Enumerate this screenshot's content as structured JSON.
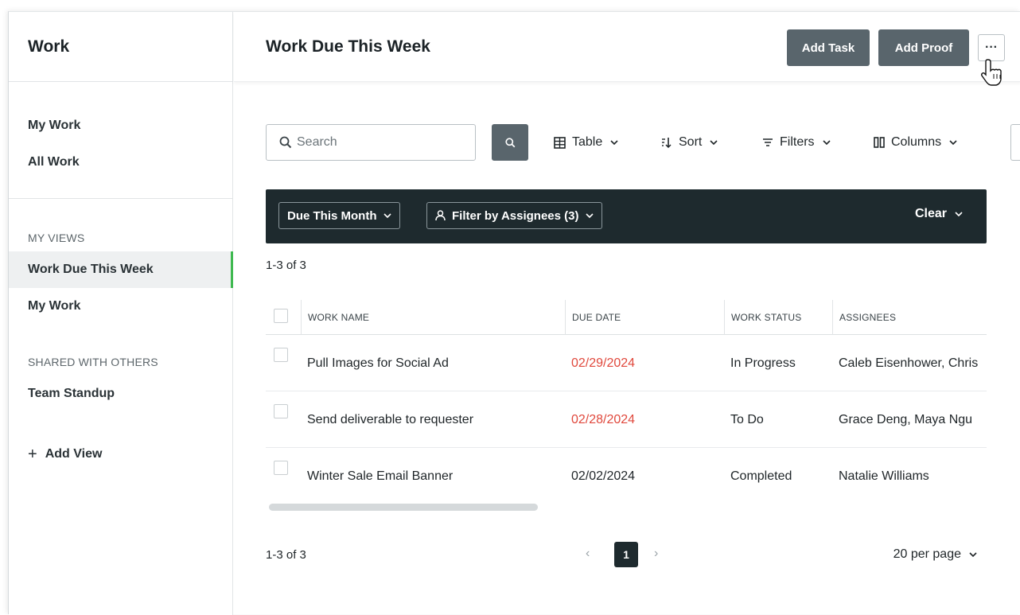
{
  "sidebar": {
    "title": "Work",
    "links": [
      {
        "label": "My Work"
      },
      {
        "label": "All Work"
      }
    ],
    "my_views_caption": "MY VIEWS",
    "my_views": [
      {
        "label": "Work Due This Week",
        "active": true
      },
      {
        "label": "My Work",
        "active": false
      }
    ],
    "shared_caption": "SHARED WITH OTHERS",
    "shared_views": [
      {
        "label": "Team Standup"
      }
    ],
    "add_view_label": "Add View"
  },
  "header": {
    "title": "Work Due This Week",
    "add_task_label": "Add Task",
    "add_proof_label": "Add Proof",
    "more_label": "···"
  },
  "toolbar": {
    "search_placeholder": "Search",
    "table_label": "Table",
    "sort_label": "Sort",
    "filters_label": "Filters",
    "columns_label": "Columns"
  },
  "filterbar": {
    "due_label": "Due This Month",
    "assignees_label": "Filter by Assignees (3)",
    "clear_label": "Clear"
  },
  "results": {
    "range_top": "1-3 of 3",
    "range_bottom": "1-3 of 3"
  },
  "table": {
    "columns": [
      "WORK NAME",
      "DUE DATE",
      "WORK STATUS",
      "ASSIGNEES"
    ],
    "rows": [
      {
        "name": "Pull Images for Social Ad",
        "due": "02/29/2024",
        "status": "In Progress",
        "assignees": "Caleb Eisenhower, Chris",
        "overdue": true
      },
      {
        "name": "Send deliverable to requester",
        "due": "02/28/2024",
        "status": "To Do",
        "assignees": "Grace Deng, Maya Ngu",
        "overdue": true
      },
      {
        "name": "Winter Sale Email Banner",
        "due": "02/02/2024",
        "status": "Completed",
        "assignees": "Natalie Williams",
        "overdue": false
      }
    ]
  },
  "pagination": {
    "current_page": "1",
    "prev_icon": "chevron-left-icon",
    "next_icon": "chevron-right-icon",
    "per_page_label": "20 per page"
  },
  "colors": {
    "accent_active": "#3fb950",
    "overdue": "#e0483c",
    "dark_button": "#59656c",
    "filter_bar": "#1e2a2e"
  }
}
